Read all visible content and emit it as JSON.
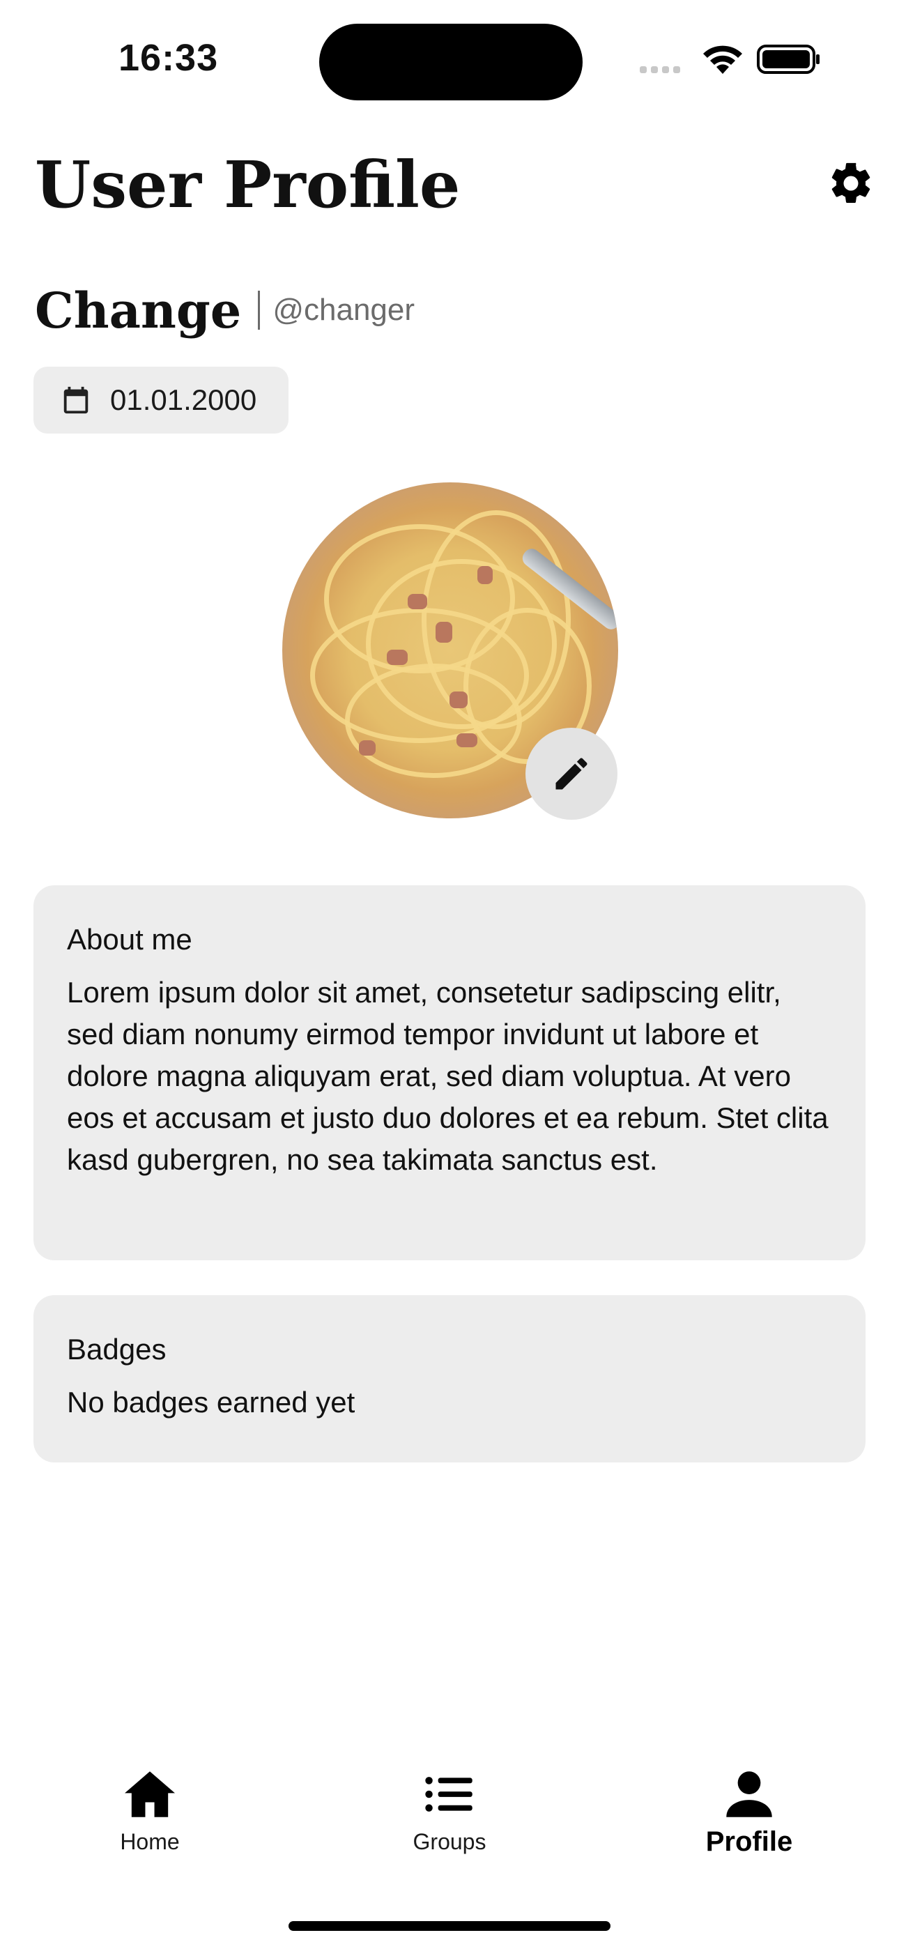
{
  "status_bar": {
    "time": "16:33"
  },
  "header": {
    "title": "User Profile"
  },
  "profile": {
    "display_name": "Change",
    "username": "@changer",
    "birth_date": "01.01.2000"
  },
  "about": {
    "heading": "About me",
    "text": "Lorem ipsum dolor sit amet, consetetur sadipscing elitr, sed diam nonumy eirmod tempor invidunt ut labore et dolore magna aliquyam erat, sed diam voluptua. At vero eos et accusam et justo duo dolores et ea rebum. Stet clita kasd gubergren, no sea takimata sanctus est."
  },
  "badges": {
    "heading": "Badges",
    "empty_text": "No badges earned yet"
  },
  "nav": {
    "items": [
      {
        "label": "Home",
        "icon": "home-icon"
      },
      {
        "label": "Groups",
        "icon": "list-icon"
      },
      {
        "label": "Profile",
        "icon": "person-icon",
        "active": true
      }
    ]
  }
}
